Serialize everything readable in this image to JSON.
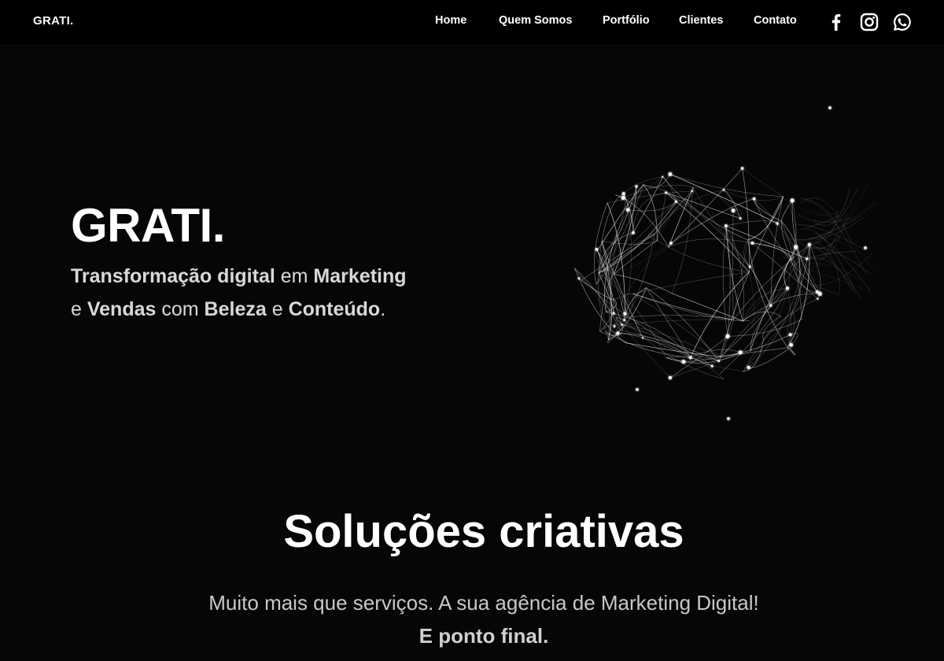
{
  "header": {
    "logo": "GRATI.",
    "nav": [
      {
        "label": "Home",
        "name": "nav-home"
      },
      {
        "label": "Quem Somos",
        "name": "nav-quem-somos"
      },
      {
        "label": "Portfólio",
        "name": "nav-portfolio"
      },
      {
        "label": "Clientes",
        "name": "nav-clientes"
      },
      {
        "label": "Contato",
        "name": "nav-contato"
      }
    ],
    "social": [
      "facebook-icon",
      "instagram-icon",
      "whatsapp-icon"
    ]
  },
  "hero": {
    "title": "GRATI.",
    "tagline": {
      "w1": "Transformação digital",
      "t1": " em ",
      "w2": "Marketing",
      "t2": "e ",
      "w3": "Vendas",
      "t3": " com ",
      "w4": "Beleza",
      "t4": " e ",
      "w5": "Conteúdo",
      "t5": "."
    },
    "graphic": "particle-sphere"
  },
  "solutions": {
    "title": "Soluções criativas",
    "subtitle": "Muito mais que serviços. A sua agência de Marketing Digital!",
    "emphasis": "E ponto final."
  },
  "colors": {
    "background": "#060606",
    "header_bg": "#000000",
    "text": "#ffffff",
    "muted_text": "#c8c8c8"
  }
}
